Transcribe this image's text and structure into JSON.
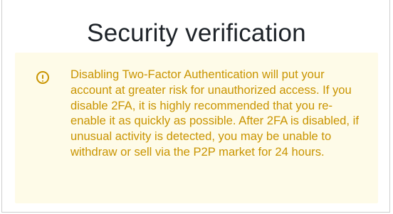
{
  "dialog": {
    "title": "Security verification"
  },
  "warning": {
    "icon": "exclamation-circle-icon",
    "message": "Disabling Two-Factor Authentication will put your account at greater risk for unauthorized access. If you disable 2FA, it is highly recommended that you re-enable it as quickly as possible. After 2FA is disabled, if unusual activity is detected, you may be unable to withdraw or sell via the P2P market for 24 hours."
  },
  "colors": {
    "warning_text": "#c99400",
    "warning_background": "#fefbe8",
    "title_text": "#1e2329"
  }
}
